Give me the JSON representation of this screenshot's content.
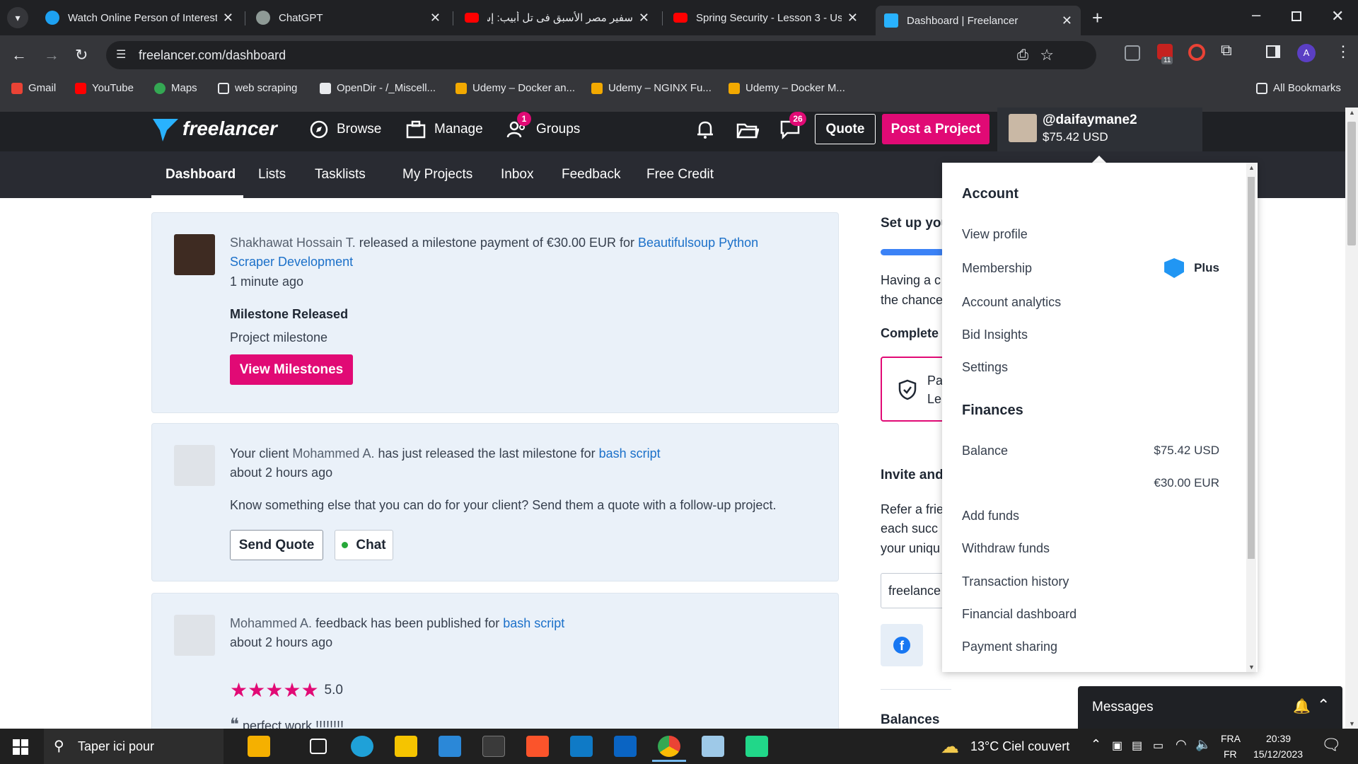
{
  "browser": {
    "tabs": [
      {
        "title": "Watch Online Person of Interest",
        "color": "#1da1f2"
      },
      {
        "title": "ChatGPT",
        "color": "#8e9a96"
      },
      {
        "title": "سفير مصر الأسبق فى تل أبيب: إس...",
        "color": "#ff0000"
      },
      {
        "title": "Spring Security - Lesson 3 - Use",
        "color": "#ff0000"
      },
      {
        "title": "Dashboard | Freelancer",
        "color": "#29b2fe"
      }
    ],
    "url": "freelancer.com/dashboard",
    "bookmarks": [
      {
        "label": "Gmail",
        "color": "#ea4335"
      },
      {
        "label": "YouTube",
        "color": "#ff0000"
      },
      {
        "label": "Maps",
        "color": "#34a853"
      },
      {
        "label": "web scraping",
        "color": "#9aa0a6"
      },
      {
        "label": "OpenDir - /_Miscell...",
        "color": "#e8eaed"
      },
      {
        "label": "Udemy – Docker an...",
        "color": "#f2a900"
      },
      {
        "label": "Udemy – NGINX Fu...",
        "color": "#f2a900"
      },
      {
        "label": "Udemy – Docker M...",
        "color": "#f2a900"
      }
    ],
    "all_bookmarks": "All Bookmarks",
    "ext_badge": "11",
    "profile_initial": "A"
  },
  "header": {
    "logo": "freelancer",
    "nav": [
      {
        "label": "Browse"
      },
      {
        "label": "Manage"
      },
      {
        "label": "Groups",
        "badge": "1"
      }
    ],
    "messages_badge": "26",
    "quote_label": "Quote",
    "post_project_label": "Post a Project",
    "username": "@daifaymane2",
    "balance": "$75.42 USD"
  },
  "subnav": [
    "Dashboard",
    "Lists",
    "Tasklists",
    "My Projects",
    "Inbox",
    "Feedback",
    "Free Credit"
  ],
  "feed": [
    {
      "user": "Shakhawat Hossain T.",
      "action_pre": " released a milestone payment of €30.00 EUR for ",
      "project_line1": "Beautifulsoup Python",
      "project_line2": "Scraper Development",
      "time": "1 minute ago",
      "heading": "Milestone Released",
      "body": "Project milestone",
      "button": "View Milestones"
    },
    {
      "pre": "Your client ",
      "user": "Mohammed A.",
      "action": " has just released the last milestone for ",
      "project": "bash script",
      "time": "about 2 hours ago",
      "body": "Know something else that you can do for your client? Send them a quote with a follow-up project.",
      "button1": "Send Quote",
      "button2": "Chat"
    },
    {
      "user": "Mohammed A.",
      "action": " feedback has been published for ",
      "project": "bash script",
      "time": "about 2 hours ago",
      "rating": "5.0",
      "stars": 5,
      "quote": "perfect work !!!!!!!!"
    }
  ],
  "right_panel": {
    "setup": "Set up you",
    "having1": "Having a c",
    "having2": "the chance",
    "complete": "Complete y",
    "pa1": "Pa",
    "pa2": "Le",
    "invite": "Invite and",
    "refer1": "Refer a frie",
    "refer2": "each succ",
    "refer3": "your uniqu",
    "link_input": "freelance",
    "balances": "Balances"
  },
  "dropdown": {
    "account_heading": "Account",
    "account_items": [
      "View profile",
      "Membership",
      "Account analytics",
      "Bid Insights",
      "Settings"
    ],
    "membership_badge": "Plus",
    "finances_heading": "Finances",
    "balance_label": "Balance",
    "balance_usd": "$75.42 USD",
    "balance_eur": "€30.00 EUR",
    "finance_items": [
      "Add funds",
      "Withdraw funds",
      "Transaction history",
      "Financial dashboard",
      "Payment sharing"
    ]
  },
  "messages_bar": "Messages",
  "taskbar": {
    "search": "Taper ici pour",
    "weather": "13°C  Ciel couvert",
    "lang1": "FRA",
    "lang2": "FR",
    "time": "20:39",
    "date": "15/12/2023"
  },
  "colors": {
    "pink": "#e10a75",
    "link": "#1b70c9",
    "header_bg": "#1f2125",
    "subnav_bg": "#292b32",
    "card_bg": "#eaf1f9"
  }
}
